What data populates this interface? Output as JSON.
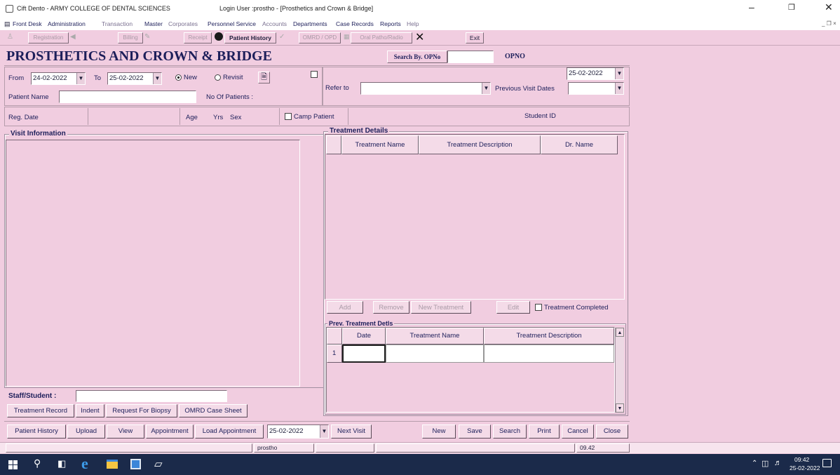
{
  "window": {
    "title_left": "Cift Dento - ARMY COLLEGE OF DENTAL SCIENCES",
    "title_center": "Login User :prostho - [Prosthetics and Crown & Bridge]"
  },
  "menu": [
    "Front Desk",
    "Administration",
    "Transaction",
    "Master",
    "Corporates",
    "Personnel Service",
    "Accounts",
    "Departments",
    "Case Records",
    "Reports",
    "Help"
  ],
  "toolbar": {
    "registration": "Registration",
    "billing": "Billing",
    "receipt": "Receipt",
    "patient_history": "Patient History",
    "omrd": "OMRD / OPD",
    "oral_patho": "Oral Patho/Radio",
    "exit": "Exit"
  },
  "form": {
    "title": "PROSTHETICS AND CROWN & BRIDGE",
    "search_by_label": "Search By. OPNo",
    "opno_label": "OPNO",
    "from_label": "From",
    "from_date": "24-02-2022",
    "to_label": "To",
    "to_date": "25-02-2022",
    "new_label": "New",
    "revisit_label": "Revisit",
    "refer_to_label": "Refer to",
    "prev_visit_label": "Previous Visit Dates",
    "visit_date": "25-02-2022",
    "patient_name_label": "Patient Name",
    "no_of_patients_label": "No Of Patients :",
    "reg_date_label": "Reg. Date",
    "age_label": "Age",
    "yrs_label": "Yrs",
    "sex_label": "Sex",
    "camp_patient_label": "Camp Patient",
    "student_id_label": "Student ID"
  },
  "visit_info": {
    "title": "Visit Information"
  },
  "treatment": {
    "title": "Treatment Details",
    "columns": [
      "Treatment Name",
      "Treatment Description",
      "Dr. Name"
    ],
    "add": "Add",
    "remove": "Remove",
    "new_treatment": "New Treatment",
    "edit": "Edit",
    "completed_label": "Treatment Completed"
  },
  "prev_treatment": {
    "title": "Prev. Treatment Detls",
    "columns": [
      "Date",
      "Treatment Name",
      "Treatment Description"
    ],
    "row_number": "1"
  },
  "staff": {
    "label": "Staff/Student :",
    "buttons": [
      "Treatment Record",
      "Indent",
      "Request For Biopsy",
      "OMRD Case Sheet"
    ]
  },
  "bottom": {
    "patient_history": "Patient History",
    "upload": "Upload",
    "view": "View",
    "appointment": "Appointment",
    "load_appointment": "Load Appointment",
    "date": "25-02-2022",
    "next_visit": "Next Visit",
    "new": "New",
    "save": "Save",
    "search": "Search",
    "print": "Print",
    "cancel": "Cancel",
    "close": "Close"
  },
  "status": {
    "user": "prostho",
    "time": "09.42"
  },
  "taskbar": {
    "time": "09:42",
    "date": "25-02-2022"
  },
  "colors": {
    "background": "#f1cde0",
    "taskbar": "#1b2a4a",
    "accent_text": "#1d1f5a"
  }
}
